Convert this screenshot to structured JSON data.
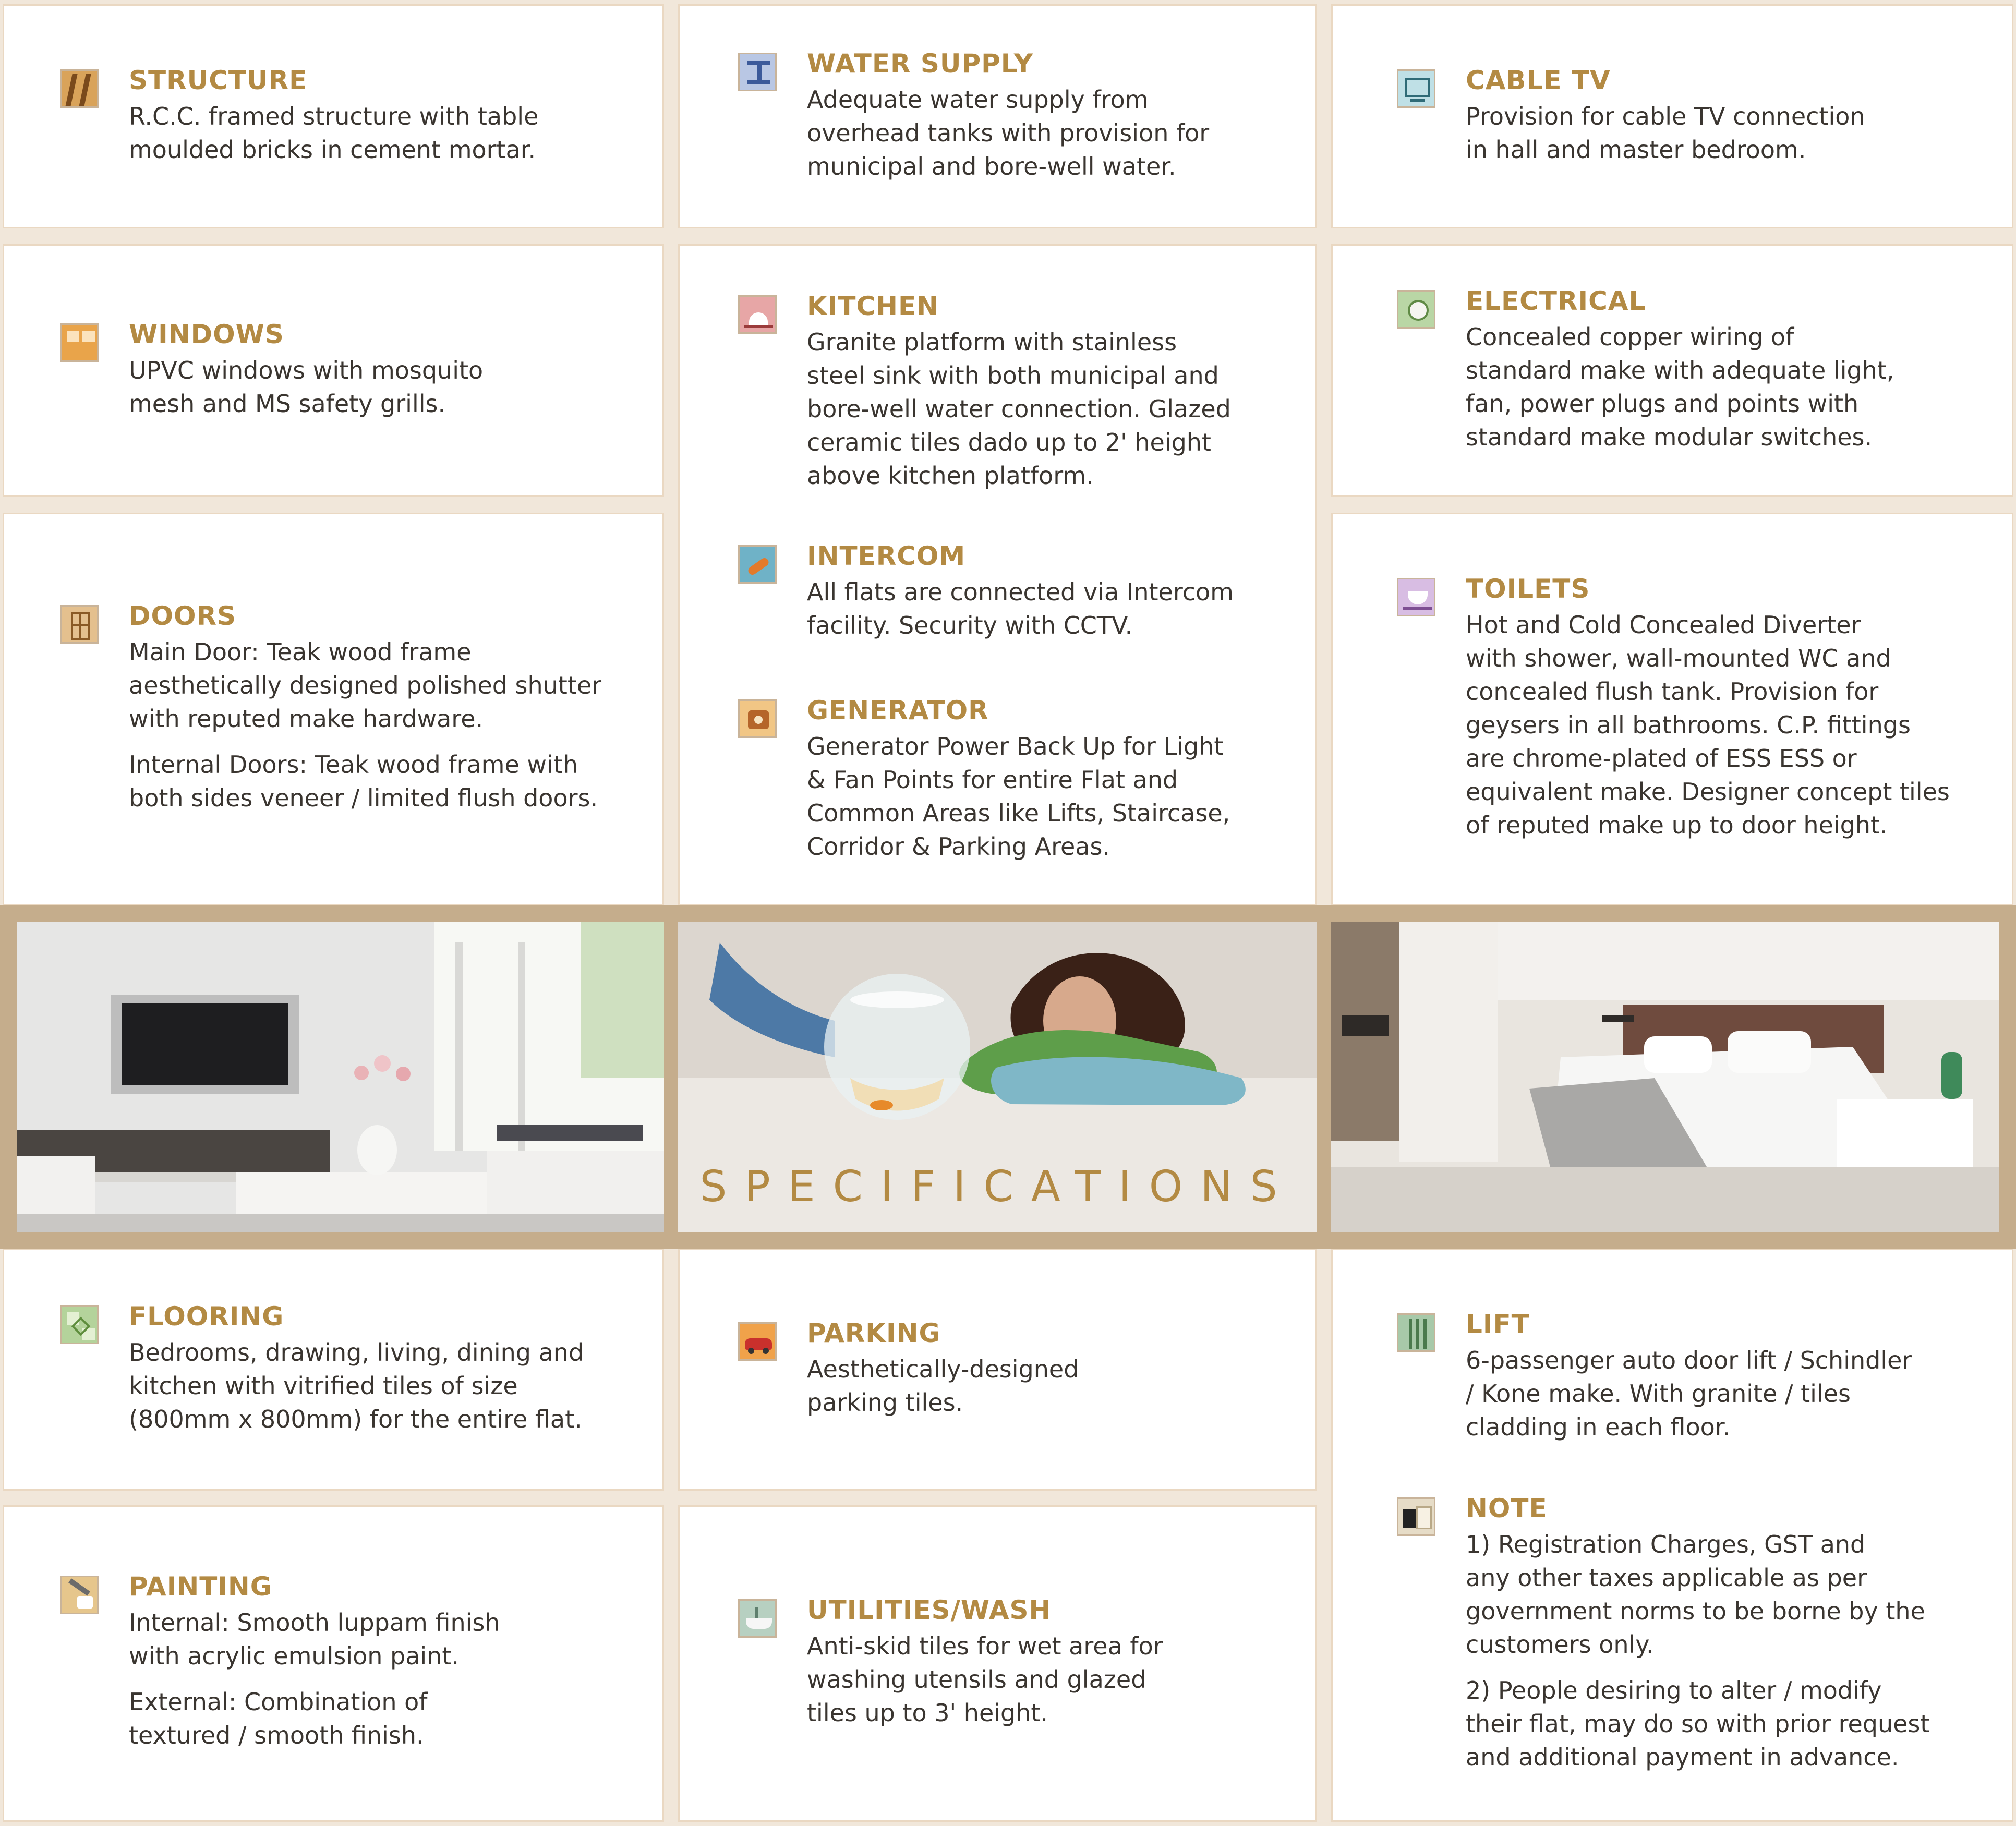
{
  "banner": {
    "title": "SPECIFICATIONS"
  },
  "specs": {
    "structure": {
      "title": "STRUCTURE",
      "text": [
        "R.C.C. framed structure with table\nmoulded bricks in cement mortar."
      ]
    },
    "water_supply": {
      "title": "WATER SUPPLY",
      "text": [
        "Adequate water supply from\noverhead tanks with provision for\nmunicipal and bore-well water."
      ]
    },
    "cable_tv": {
      "title": "CABLE TV",
      "text": [
        "Provision for cable TV connection\nin hall and master bedroom."
      ]
    },
    "windows": {
      "title": "WINDOWS",
      "text": [
        "UPVC windows with mosquito\nmesh and MS safety grills."
      ]
    },
    "kitchen": {
      "title": "KITCHEN",
      "text": [
        "Granite platform with stainless\nsteel sink with both municipal and\nbore-well water connection. Glazed\nceramic tiles dado up to 2' height\nabove kitchen platform."
      ]
    },
    "electrical": {
      "title": "ELECTRICAL",
      "text": [
        "Concealed copper wiring of\nstandard make with adequate light,\nfan, power plugs and points with\nstandard make modular switches."
      ]
    },
    "doors": {
      "title": "DOORS",
      "text": [
        "Main Door: Teak wood frame\naesthetically designed polished shutter\nwith reputed make hardware.",
        "Internal Doors: Teak wood frame with\nboth sides veneer / limited flush doors."
      ]
    },
    "intercom": {
      "title": "INTERCOM",
      "text": [
        "All flats are connected via Intercom\nfacility. Security with CCTV."
      ]
    },
    "generator": {
      "title": "GENERATOR",
      "text": [
        "Generator Power Back Up for Light\n& Fan Points for entire Flat and\nCommon Areas like Lifts, Staircase,\nCorridor & Parking Areas."
      ]
    },
    "toilets": {
      "title": "TOILETS",
      "text": [
        "Hot and Cold Concealed Diverter\nwith shower, wall-mounted WC and\nconcealed flush tank. Provision for\ngeysers in all bathrooms. C.P. fittings\nare chrome-plated of ESS ESS or\nequivalent make. Designer concept tiles\nof reputed make up to door height."
      ]
    },
    "flooring": {
      "title": "FLOORING",
      "text": [
        "Bedrooms, drawing, living, dining and\nkitchen with vitrified tiles of size\n(800mm x 800mm) for the entire flat."
      ]
    },
    "parking": {
      "title": "PARKING",
      "text": [
        "Aesthetically-designed\nparking tiles."
      ]
    },
    "lift": {
      "title": "LIFT",
      "text": [
        "6-passenger auto door lift / Schindler\n/ Kone make. With granite / tiles\ncladding in each floor."
      ]
    },
    "painting": {
      "title": "PAINTING",
      "text": [
        "Internal: Smooth luppam finish\nwith acrylic emulsion paint.",
        "External: Combination of\ntextured / smooth finish."
      ]
    },
    "utilities": {
      "title": "UTILITIES/WASH",
      "text": [
        "Anti-skid tiles for wet area for\nwashing utensils and glazed\ntiles up to 3' height."
      ]
    },
    "note": {
      "title": "NOTE",
      "text": [
        "1) Registration Charges, GST and\nany other taxes applicable as per\ngovernment norms to be borne by the\ncustomers only.",
        "2) People desiring to alter / modify\ntheir flat, may do so with prior request\nand additional payment in advance."
      ]
    }
  },
  "colors": {
    "heading": "#b38a43",
    "body_text": "#3a3530",
    "band": "#c5ad8c",
    "card_border": "#ead8c2",
    "background": "#f1e7da"
  }
}
